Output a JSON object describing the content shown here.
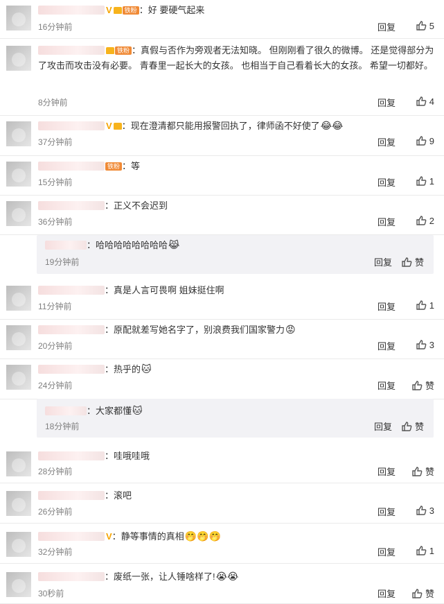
{
  "comments": [
    {
      "id": "c1",
      "text": "好 要硬气起来",
      "badges": [
        "V",
        "crown",
        "铁粉"
      ],
      "time": "16分钟前",
      "reply_label": "回复",
      "likes": "5"
    },
    {
      "id": "c2",
      "text": "真假与否作为旁观者无法知晓。 但刚刚看了很久的微博。 还是觉得部分为了攻击而攻击没有必要。 青春里一起长大的女孩。 也相当于自己看着长大的女孩。 希望一切都好。",
      "badges": [
        "crown",
        "铁粉"
      ],
      "time": "8分钟前",
      "reply_label": "回复",
      "likes": "4"
    },
    {
      "id": "c3",
      "text": "现在澄清都只能用报警回执了，律师函不好使了",
      "emoji": "😂😂",
      "badges": [
        "V",
        "crown"
      ],
      "time": "37分钟前",
      "reply_label": "回复",
      "likes": "9"
    },
    {
      "id": "c4",
      "text": "等",
      "badges": [
        "铁粉"
      ],
      "time": "15分钟前",
      "reply_label": "回复",
      "likes": "1"
    },
    {
      "id": "c5",
      "text": "正义不会迟到",
      "badges": [],
      "time": "36分钟前",
      "reply_label": "回复",
      "likes": "2"
    },
    {
      "id": "c6",
      "text": "真是人言可畏啊 姐妹挺住啊",
      "badges": [],
      "time": "11分钟前",
      "reply_label": "回复",
      "likes": "1"
    },
    {
      "id": "c7",
      "text": "原配就差写她名字了，别浪费我们国家警力",
      "emoji": "😡",
      "badges": [],
      "time": "20分钟前",
      "reply_label": "回复",
      "likes": "3"
    },
    {
      "id": "c8",
      "text": "热乎的",
      "emoji": "🐱",
      "badges": [],
      "time": "24分钟前",
      "reply_label": "回复",
      "likes": "赞"
    },
    {
      "id": "c9",
      "text": "哇哦哇哦",
      "badges": [],
      "time": "28分钟前",
      "reply_label": "回复",
      "likes": "赞"
    },
    {
      "id": "c10",
      "text": "滚吧",
      "badges": [],
      "time": "26分钟前",
      "reply_label": "回复",
      "likes": "3"
    },
    {
      "id": "c11",
      "text": "静等事情的真相",
      "emoji": "🤭🤭🤭",
      "badges": [
        "V"
      ],
      "time": "32分钟前",
      "reply_label": "回复",
      "likes": "1"
    },
    {
      "id": "c12",
      "text": "废纸一张，让人锤啥样了!",
      "emoji": "😭😭",
      "badges": [],
      "time": "30秒前",
      "reply_label": "回复",
      "likes": "赞"
    }
  ],
  "replies": [
    {
      "id": "r1",
      "text": "哈哈哈哈哈哈哈哈",
      "emoji": "😹",
      "time": "19分钟前",
      "reply_label": "回复",
      "likes": "赞"
    },
    {
      "id": "r2",
      "text": "大家都懂",
      "emoji": "🐱",
      "time": "18分钟前",
      "reply_label": "回复",
      "likes": "赞"
    }
  ]
}
